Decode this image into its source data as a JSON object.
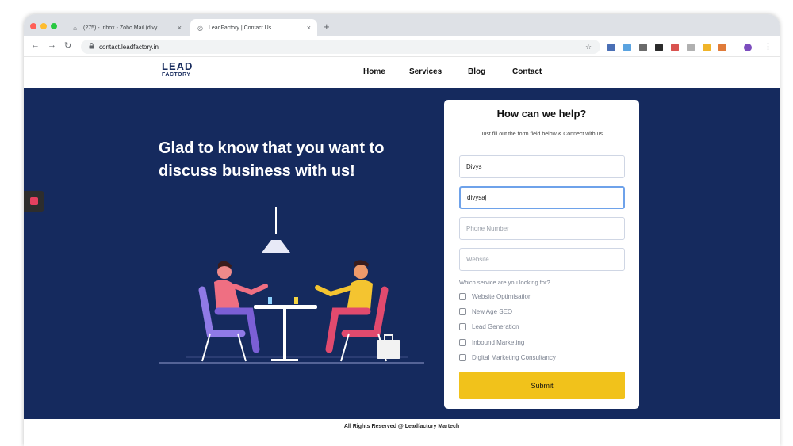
{
  "browser": {
    "tabs": [
      {
        "title": "(275) - Inbox - Zoho Mail (divy",
        "close": "×",
        "favicon": "zoho-mail-icon"
      },
      {
        "title": "LeadFactory | Contact Us",
        "close": "×",
        "favicon": "leadfactory-icon"
      }
    ],
    "new_tab": "+",
    "back": "←",
    "forward": "→",
    "reload": "↻",
    "lock": "🔒",
    "url": "contact.leadfactory.in",
    "bookmark": "☆",
    "menu": "⋮"
  },
  "site": {
    "logo_line1": "LEAD",
    "logo_line2": "FACTORY",
    "nav": [
      {
        "label": "Home"
      },
      {
        "label": "Services"
      },
      {
        "label": "Blog"
      },
      {
        "label": "Contact"
      }
    ],
    "headline": "Glad to know that you want to discuss business with us!",
    "footer": "All Rights Reserved @ Leadfactory Martech"
  },
  "form": {
    "title": "How can we help?",
    "subtitle": "Just fill out the form field below & Connect with us",
    "name_value": "Divys",
    "email_value": "divysa|",
    "phone_placeholder": "Phone Number",
    "website_placeholder": "Website",
    "question": "Which service are you looking for?",
    "services": [
      {
        "label": "Website Optimisation"
      },
      {
        "label": "New Age SEO"
      },
      {
        "label": "Lead Generation"
      },
      {
        "label": "Inbound Marketing"
      },
      {
        "label": "Digital Marketing Consultancy"
      }
    ],
    "submit_label": "Submit"
  },
  "colors": {
    "hero_bg": "#152a5e",
    "submit_bg": "#f1c21b",
    "focus_border": "#6ea2ea"
  }
}
